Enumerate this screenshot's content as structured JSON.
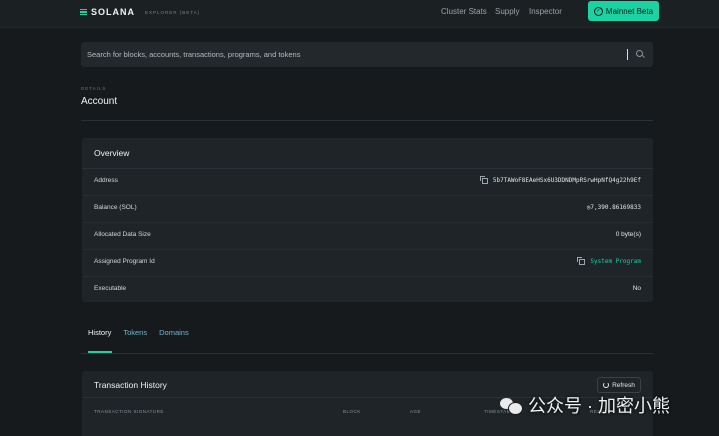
{
  "header": {
    "logo_text": "SOLANA",
    "logo_sub": "EXPLORER (BETA)",
    "nav": [
      "Cluster Stats",
      "Supply",
      "Inspector"
    ],
    "cluster_button": "Mainnet Beta"
  },
  "search": {
    "placeholder": "Search for blocks, accounts, transactions, programs, and tokens"
  },
  "page": {
    "eyebrow": "DETAILS",
    "title": "Account"
  },
  "overview": {
    "title": "Overview",
    "rows": [
      {
        "label": "Address",
        "value": "5b7TAWoF8EAeHSx6U3DDNDMpRSrwHpNfQ4g22h9Ef"
      },
      {
        "label": "Balance (SOL)",
        "value": "◎7,390.86169833"
      },
      {
        "label": "Allocated Data Size",
        "value": "0 byte(s)"
      },
      {
        "label": "Assigned Program Id",
        "value": "System Program"
      },
      {
        "label": "Executable",
        "value": "No"
      }
    ]
  },
  "tabs": [
    "History",
    "Tokens",
    "Domains"
  ],
  "history": {
    "title": "Transaction History",
    "refresh_label": "Refresh",
    "columns": [
      "TRANSACTION SIGNATURE",
      "BLOCK",
      "AGE",
      "TIMESTAMP",
      "RESULT"
    ]
  },
  "watermark": "公众号 · 加密小熊",
  "colors": {
    "accent": "#19d3a2",
    "background": "#161a1d",
    "card": "#1e2427"
  }
}
